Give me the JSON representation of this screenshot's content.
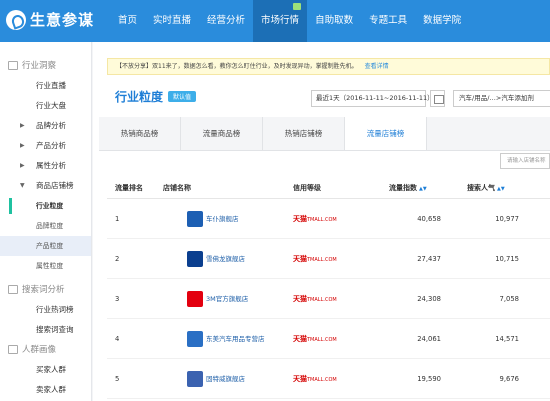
{
  "app": {
    "title": "生意参谋"
  },
  "nav": [
    {
      "label": "首页"
    },
    {
      "label": "实时直播"
    },
    {
      "label": "经营分析"
    },
    {
      "label": "市场行情"
    },
    {
      "label": "自助取数"
    },
    {
      "label": "专题工具"
    },
    {
      "label": "数据学院"
    }
  ],
  "sidebar": {
    "group1": "行业洞察",
    "items1": [
      {
        "label": "行业直播"
      },
      {
        "label": "行业大盘"
      },
      {
        "label": "品牌分析"
      },
      {
        "label": "产品分析"
      },
      {
        "label": "属性分析"
      },
      {
        "label": "商品店铺榜"
      }
    ],
    "subs": [
      {
        "label": "行业粒度"
      },
      {
        "label": "品牌粒度"
      },
      {
        "label": "产品粒度"
      },
      {
        "label": "属性粒度"
      }
    ],
    "group2": "搜索词分析",
    "items2": [
      {
        "label": "行业热词榜"
      },
      {
        "label": "搜索词查询"
      }
    ],
    "group3": "人群画像",
    "items3": [
      {
        "label": "买家人群"
      },
      {
        "label": "卖家人群"
      }
    ]
  },
  "notice": {
    "text": "【不放分享】双11来了，数据怎么看，教你怎么盯住行业，及时发现异动，掌握制胜先机。",
    "link": "查看详情"
  },
  "page": {
    "title": "行业粒度",
    "badge": "默认值",
    "date_range": "最近1天（2016-11-11~2016-11-11）",
    "category": "汽车/用品/…>汽车添加剂"
  },
  "tabs": [
    {
      "label": "热销商品榜"
    },
    {
      "label": "流量商品榜"
    },
    {
      "label": "热销店铺榜"
    },
    {
      "label": "流量店铺榜"
    }
  ],
  "search": {
    "placeholder": "请输入店铺名称"
  },
  "table": {
    "headers": {
      "rank": "流量排名",
      "shop": "店铺名称",
      "credit": "信用等级",
      "traffic": "流量指数",
      "search": "搜索人气"
    },
    "rows": [
      {
        "rank": "1",
        "shop": "车仆旗舰店",
        "credit_main": "天猫",
        "credit_sub": "TMALL.COM",
        "traffic": "40,658",
        "search": "10,977",
        "logo_color": "#1d5fb3"
      },
      {
        "rank": "2",
        "shop": "雪佛龙旗舰店",
        "credit_main": "天猫",
        "credit_sub": "TMALL.COM",
        "traffic": "27,437",
        "search": "10,715",
        "logo_color": "#0b3f8f"
      },
      {
        "rank": "3",
        "shop": "3M官方旗舰店",
        "credit_main": "天猫",
        "credit_sub": "TMALL.COM",
        "traffic": "24,308",
        "search": "7,058",
        "logo_color": "#e3000f"
      },
      {
        "rank": "4",
        "shop": "东美汽车用品专营店",
        "credit_main": "天猫",
        "credit_sub": "TMALL.COM",
        "traffic": "24,061",
        "search": "14,571",
        "logo_color": "#2a6fc4"
      },
      {
        "rank": "5",
        "shop": "固特威旗舰店",
        "credit_main": "天猫",
        "credit_sub": "TMALL.COM",
        "traffic": "19,590",
        "search": "9,676",
        "logo_color": "#3b62b0"
      }
    ]
  }
}
